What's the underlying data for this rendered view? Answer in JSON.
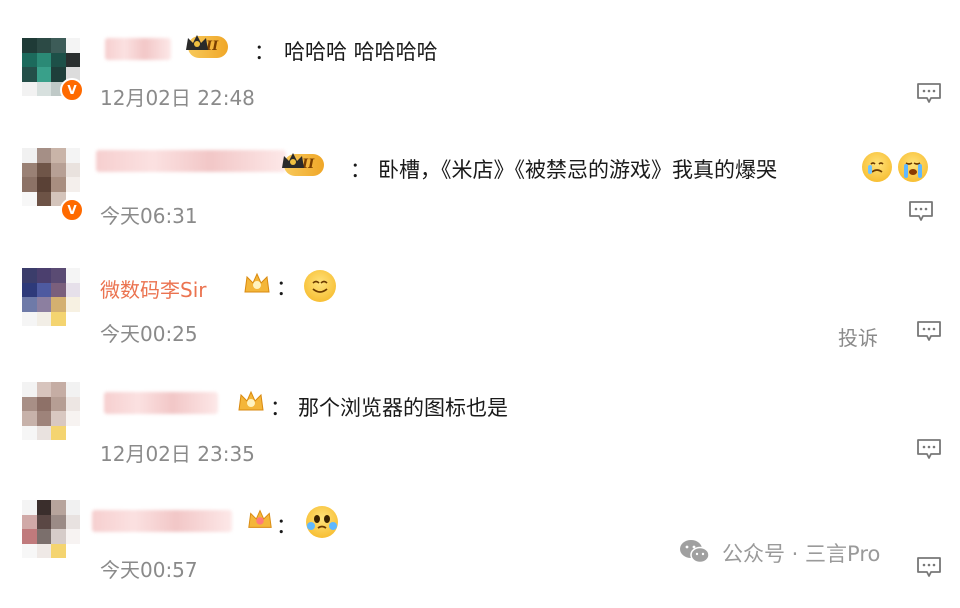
{
  "comments": [
    {
      "badge": "II",
      "separator": "：",
      "content": "哈哈哈 哈哈哈哈",
      "time": "12月02日 22:48",
      "verified_letter": "V"
    },
    {
      "badge": "II",
      "separator": "：",
      "content": "卧槽，《米店》《被禁忌的游戏》我真的爆哭",
      "emojis": [
        "crying-face-emoji",
        "loudly-crying-face-emoji"
      ],
      "time": "今天06:31",
      "verified_letter": "V"
    },
    {
      "name": "微数码李Sir",
      "separator": "：",
      "emojis": [
        "smiling-face-emoji"
      ],
      "time": "今天00:25",
      "report_label": "投诉"
    },
    {
      "separator": "：",
      "content": "那个浏览器的图标也是",
      "time": "12月02日 23:35"
    },
    {
      "separator": "：",
      "emojis": [
        "moved-face-emoji"
      ],
      "time": "今天00:57"
    }
  ],
  "watermark": {
    "text": "公众号 · 三言Pro"
  },
  "colors": {
    "username_link": "#eb7350",
    "verified_badge": "#ff6a00",
    "timestamp": "#8a8a8a",
    "rank_badge": "#f0a728"
  }
}
